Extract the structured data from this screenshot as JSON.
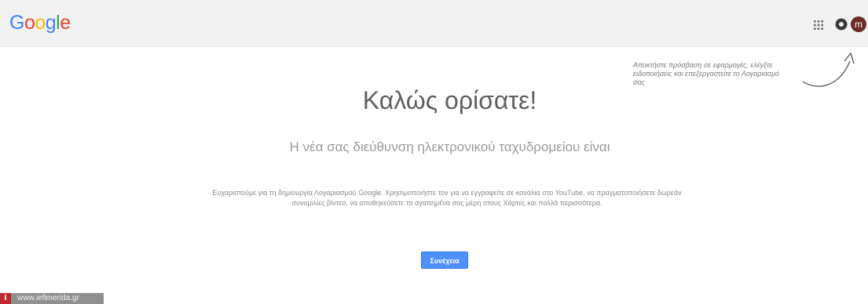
{
  "header": {
    "logo_letters": [
      "G",
      "o",
      "o",
      "g",
      "l",
      "e"
    ],
    "avatar_initial": "m",
    "icons": {
      "apps": "apps-grid-icon",
      "notifications": "notifications-icon"
    }
  },
  "hint": {
    "text": "Αποκτήστε πρόσβαση σε εφαρμογές, ελέγξτε ειδοποιήσεις και επεξεργαστείτε το Λογαριασμό σας"
  },
  "main": {
    "title": "Καλώς ορίσατε!",
    "email_line": "Η νέα σας διεύθυνση ηλεκτρονικού ταχυδρομείου είναι",
    "description": "Ευχαριστούμε για τη δημιουργία Λογαριασμού Google. Χρησιμοποιήστε τον για να εγγραφείτε σε κανάλια στο YouTube, να πραγματοποιήσετε δωρεάν συνομιλίες βίντεο, να αποθηκεύσετε τα αγαπημένα σας μέρη στους Χάρτες και πολλά περισσότερα.",
    "continue_label": "Συνέχεια"
  },
  "watermark": {
    "badge": "i",
    "text": "www.iefimerida.gr"
  },
  "colors": {
    "topbar": "#f1f1f1",
    "button": "#4d90fe",
    "avatar": "#6b2d25",
    "watermark_badge": "#c0282d"
  }
}
